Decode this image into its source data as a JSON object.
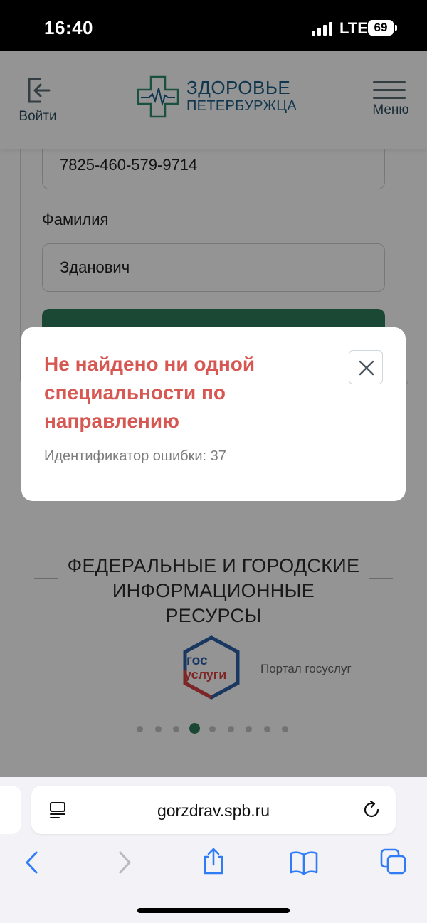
{
  "status_bar": {
    "time": "16:40",
    "network": "LTE",
    "battery": "69"
  },
  "header": {
    "login_label": "Войти",
    "logo_line1": "ЗДОРОВЬЕ",
    "logo_line2": "ПЕТЕРБУРЖЦА",
    "menu_label": "Меню"
  },
  "form": {
    "policy_value": "7825-460-579-9714",
    "surname_label": "Фамилия",
    "surname_value": "Зданович"
  },
  "modal": {
    "title": "Не найдено ни одной специальности по направлению",
    "error_id": "Идентификатор ошибки: 37"
  },
  "resources": {
    "title": "ФЕДЕРАЛЬНЫЕ И ГОРОДСКИЕ ИНФОРМАЦИОННЫЕ РЕСУРСЫ",
    "gos_logo_line1": "гос",
    "gos_logo_line2": "услуги",
    "gos_caption": "Портал госуслуг",
    "carousel_count": 9,
    "carousel_active_index": 3
  },
  "browser": {
    "url": "gorzdrav.spb.ru"
  },
  "colors": {
    "accent_green": "#2e7d5b",
    "error_red": "#d75752",
    "brand_blue": "#1b5e86"
  }
}
